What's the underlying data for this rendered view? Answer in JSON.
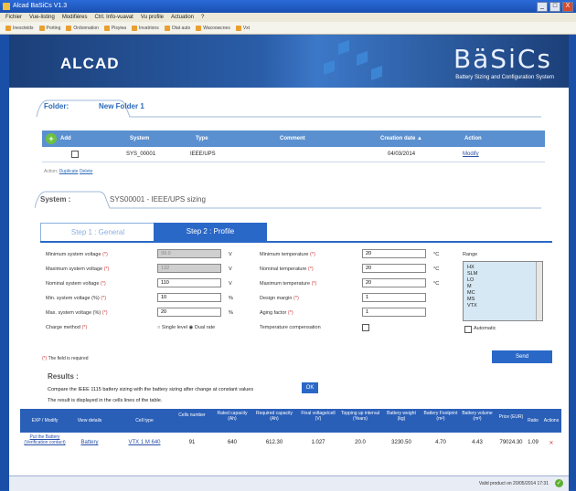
{
  "window": {
    "title": "Alcad BaSiCs V1.3",
    "buttons": [
      "_",
      "□",
      "X"
    ]
  },
  "menu": [
    "Fichier",
    "Vue-listing",
    "Modifières",
    "Ctrl. Info-vuavat",
    "Vu profile",
    "Actuation",
    "?"
  ],
  "favorites": [
    "Inescteids",
    "Porting",
    "Ordonnation",
    "Pisyiea",
    "Invatrions",
    "Otat auto",
    "Wacoowcnes",
    "Vxt"
  ],
  "banner": {
    "logo": "ALCAD",
    "product": "BäSiCs",
    "subtitle": "Battery Sizing and Configuration System"
  },
  "folder": {
    "label": "Folder:",
    "name": "New Folder 1"
  },
  "folder_table": {
    "add_label": "Add",
    "headers": [
      "System",
      "Type",
      "Comment",
      "Creation date ▲",
      "Action"
    ],
    "rows": [
      {
        "system": "SYS_00001",
        "type": "IEEE/UPS",
        "comment": "",
        "date": "04/03/2014",
        "action": "Modify"
      }
    ]
  },
  "folder_actions": {
    "prefix": "Action:",
    "duplicate": "Duplicate",
    "delete": "Delete"
  },
  "system": {
    "label": "System :",
    "name": "SYS00001 - IEEE/UPS sizing"
  },
  "steps": {
    "step1": "Step 1 : General",
    "step2": "Step 2 : Profile"
  },
  "form": {
    "left": [
      {
        "label": "Minimum system voltage",
        "value": "99.0",
        "unit": "V",
        "disabled": true
      },
      {
        "label": "Maximum system voltage",
        "value": "132",
        "unit": "V",
        "disabled": true
      },
      {
        "label": "Nominal system voltage",
        "value": "110",
        "unit": "V",
        "disabled": false
      },
      {
        "label": "Min. system voltage (%)",
        "value": "10",
        "unit": "%",
        "disabled": false
      },
      {
        "label": "Max. system voltage (%)",
        "value": "20",
        "unit": "%",
        "disabled": false
      }
    ],
    "charge_method": {
      "label": "Charge method",
      "options": "○ Single level ◉ Dual rate"
    },
    "right": [
      {
        "label": "Minimum temperature",
        "value": "20",
        "unit": "°C"
      },
      {
        "label": "Nominal temperature",
        "value": "20",
        "unit": "°C"
      },
      {
        "label": "Maximum temperature",
        "value": "20",
        "unit": "°C"
      },
      {
        "label": "Design margin",
        "value": "1",
        "unit": ""
      },
      {
        "label": "Aging factor",
        "value": "1",
        "unit": ""
      }
    ],
    "temp_comp": {
      "label": "Temperature compensation"
    },
    "range": {
      "label": "Range",
      "items": [
        "HX",
        "SLM",
        "LO",
        "M",
        "MC",
        "MS",
        "VTX"
      ]
    },
    "automatic": "Automatic"
  },
  "required_note": "The field is required",
  "send_button": "Send",
  "results": {
    "title": "Results :",
    "desc1": "Compare the IEEE 1115 battery sizing with the battery sizing after change at constant values",
    "ok": "OK",
    "desc2": "The result is displayed in the cells lines of the table.",
    "headers": [
      "EXP / Modify",
      "View details",
      "Cell type",
      "Cells number",
      "Rated capacity (Ah)",
      "Required capacity (Ah)",
      "Final voltage/cell (V)",
      "Topping up interval (Years)",
      "Battery weight (kg)",
      "Battery Footprint (m²)",
      "Battery volume (m³)",
      "Price (EUR)",
      "Ratio",
      "Actions"
    ],
    "row": {
      "c0": "Put the Battery (Verification contact)",
      "c1": "Battery",
      "c2": "VTX 1 M 640",
      "c3": "91",
      "c4": "640",
      "c5": "612.30",
      "c6": "1.027",
      "c7": "20.0",
      "c8": "3230.50",
      "c9": "4.70",
      "c10": "4.43",
      "c11": "79024.30",
      "c12": "1.09",
      "c13": "✕"
    }
  },
  "status": {
    "text": "Valid product on 20/05/2014 17:31",
    "ok": "✓"
  },
  "colors": {
    "banner": "#1c3f78",
    "accent": "#2a68c8",
    "header": "#5a90d0"
  }
}
